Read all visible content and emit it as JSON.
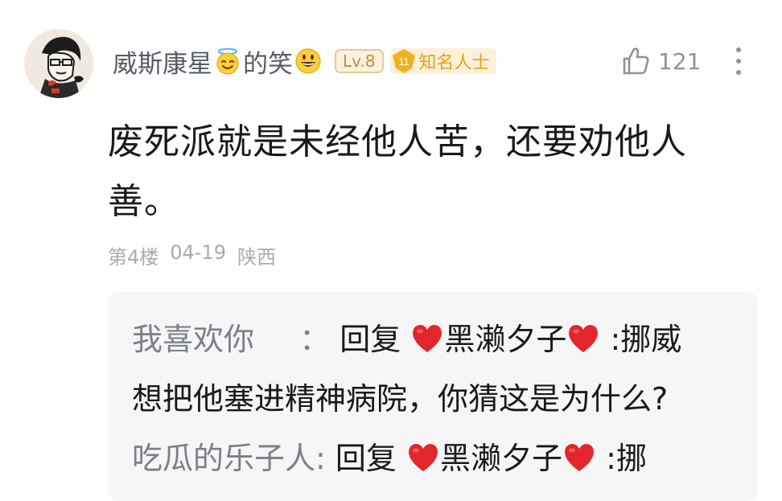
{
  "comment": {
    "user": {
      "name_part1": "威斯康星",
      "name_part2": "的笑",
      "emoji1": "halo-smile-emoji",
      "emoji2": "grin-emoji",
      "level": "Lv.8",
      "fan_level": "11",
      "fan_title": "知名人士"
    },
    "likes": "121",
    "text_line1": "废死派就是未经他人苦，还要劝他人",
    "text_line2": "善。",
    "floor": "第4楼",
    "date": "04-19",
    "location": "陕西"
  },
  "replies": [
    {
      "author": "我喜欢你",
      "separator": "：",
      "reply_word": "回复",
      "target": "黑濑夕子",
      "text": ":挪威",
      "line2": "想把他塞进精神病院，你猜这是为什么?"
    },
    {
      "author": "吃瓜的乐子人",
      "separator": ":",
      "reply_word": "回复",
      "target": "黑濑夕子",
      "text": ":挪"
    }
  ],
  "colors": {
    "username": "#555a64",
    "level_badge": "#c78a3c",
    "fan_badge": "#e5a319",
    "meta": "#a7abb2",
    "reply_author": "#7c8089",
    "heart": "#e3262b"
  }
}
